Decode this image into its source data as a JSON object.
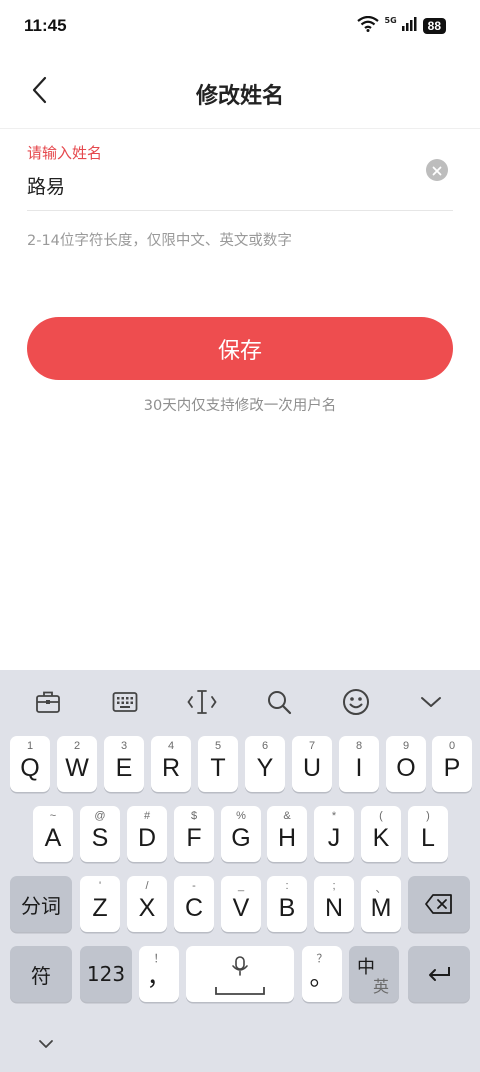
{
  "status_bar": {
    "time": "11:45",
    "network": "5G",
    "battery": "88"
  },
  "header": {
    "title": "修改姓名",
    "back_icon": "chevron-left-icon"
  },
  "form": {
    "label": "请输入姓名",
    "value": "路易",
    "hint": "2-14位字符长度，仅限中文、英文或数字",
    "label_color": "#e5484d"
  },
  "save_button": {
    "label": "保存",
    "color": "#ee4d4f"
  },
  "notice": "30天内仅支持修改一次用户名",
  "keyboard": {
    "toolbar_icons": [
      "clipboard-icon",
      "keyboard-icon",
      "text-cursor-icon",
      "search-icon",
      "emoji-icon",
      "chevron-down-icon"
    ],
    "row1": {
      "keys": [
        "Q",
        "W",
        "E",
        "R",
        "T",
        "Y",
        "U",
        "I",
        "O",
        "P"
      ],
      "subs": [
        "1",
        "2",
        "3",
        "4",
        "5",
        "6",
        "7",
        "8",
        "9",
        "0"
      ]
    },
    "row2": {
      "keys": [
        "A",
        "S",
        "D",
        "F",
        "G",
        "H",
        "J",
        "K",
        "L"
      ],
      "subs": [
        "~",
        "@",
        "#",
        "$",
        "%",
        "&",
        "*",
        "(",
        ")"
      ]
    },
    "row3": {
      "keys": [
        "Z",
        "X",
        "C",
        "V",
        "B",
        "N",
        "M"
      ],
      "subs": [
        "'",
        "/",
        "-",
        "_",
        ":",
        ";",
        "、"
      ]
    },
    "segment_label": "分词",
    "symbol_label": "符",
    "number_label": "123",
    "comma": {
      "main": "，",
      "sub": "！"
    },
    "period": {
      "main": "。",
      "sub": "？"
    },
    "lang_toggle": {
      "primary": "中",
      "secondary": "英"
    }
  }
}
